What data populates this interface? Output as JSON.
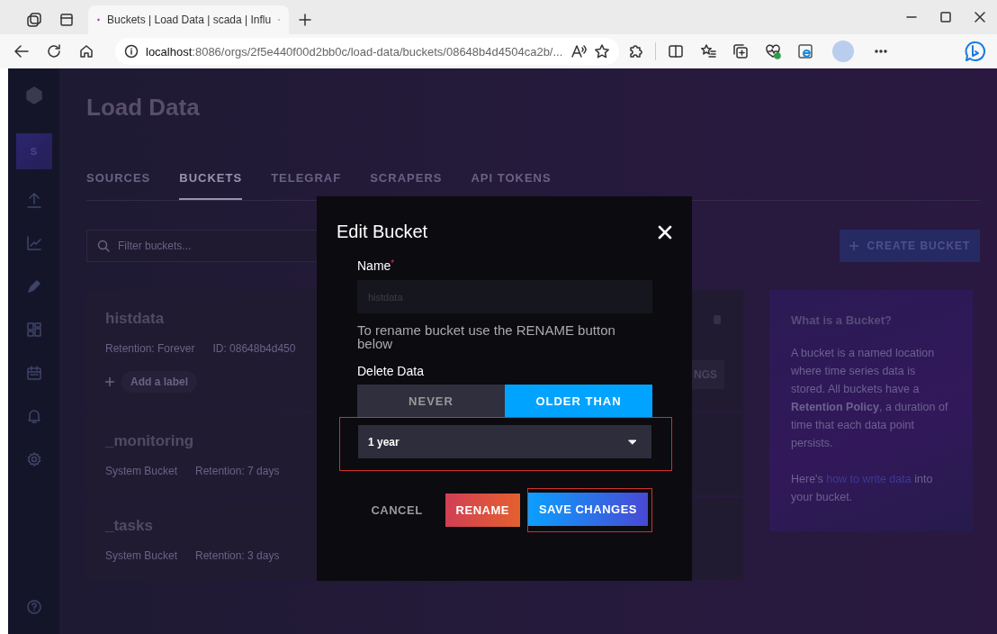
{
  "browser": {
    "tab_title": "Buckets | Load Data | scada | Influ",
    "url_host": "localhost",
    "url_path": ":8086/orgs/2f5e440f00d2bb0c/load-data/buckets/08648b4d4504ca2b/..."
  },
  "sidebar": {
    "org_initial": "S"
  },
  "page": {
    "title": "Load Data",
    "tabs": [
      {
        "label": "SOURCES",
        "selected": false
      },
      {
        "label": "BUCKETS",
        "selected": true
      },
      {
        "label": "TELEGRAF",
        "selected": false
      },
      {
        "label": "SCRAPERS",
        "selected": false
      },
      {
        "label": "API TOKENS",
        "selected": false
      }
    ],
    "filter": {
      "placeholder": "Filter buckets..."
    },
    "create_button": "CREATE BUCKET",
    "buckets": [
      {
        "name": "histdata",
        "meta": [
          "Retention: Forever",
          "ID: 08648b4d450"
        ],
        "add_label": "Add a label",
        "settings_button": "NGS"
      },
      {
        "name": "_monitoring",
        "meta": [
          "System Bucket",
          "Retention: 7 days"
        ]
      },
      {
        "name": "_tasks",
        "meta": [
          "System Bucket",
          "Retention: 3 days"
        ]
      }
    ],
    "info": {
      "title": "What is a Bucket?",
      "body": "A bucket is a named location where time series data is stored. All buckets have a **Retention Policy**, a duration of time that each data point persists.",
      "link_before": "Here's",
      "link": "how to write data",
      "link_after": "into your bucket."
    }
  },
  "modal": {
    "title": "Edit Bucket",
    "name_label": "Name",
    "required_mark": "*",
    "name_value": "histdata",
    "name_disabled": true,
    "hint": "To rename bucket use the RENAME button below",
    "delete_label": "Delete Data",
    "options": [
      {
        "label": "NEVER",
        "selected": false
      },
      {
        "label": "OLDER THAN",
        "selected": true
      }
    ],
    "retention": {
      "value": "1 year",
      "highlighted": true
    },
    "buttons": [
      {
        "kind": "cancel",
        "label": "CANCEL",
        "highlighted": false
      },
      {
        "kind": "rename",
        "label": "RENAME",
        "highlighted": false
      },
      {
        "kind": "save",
        "label": "SAVE CHANGES",
        "highlighted": true
      }
    ]
  }
}
